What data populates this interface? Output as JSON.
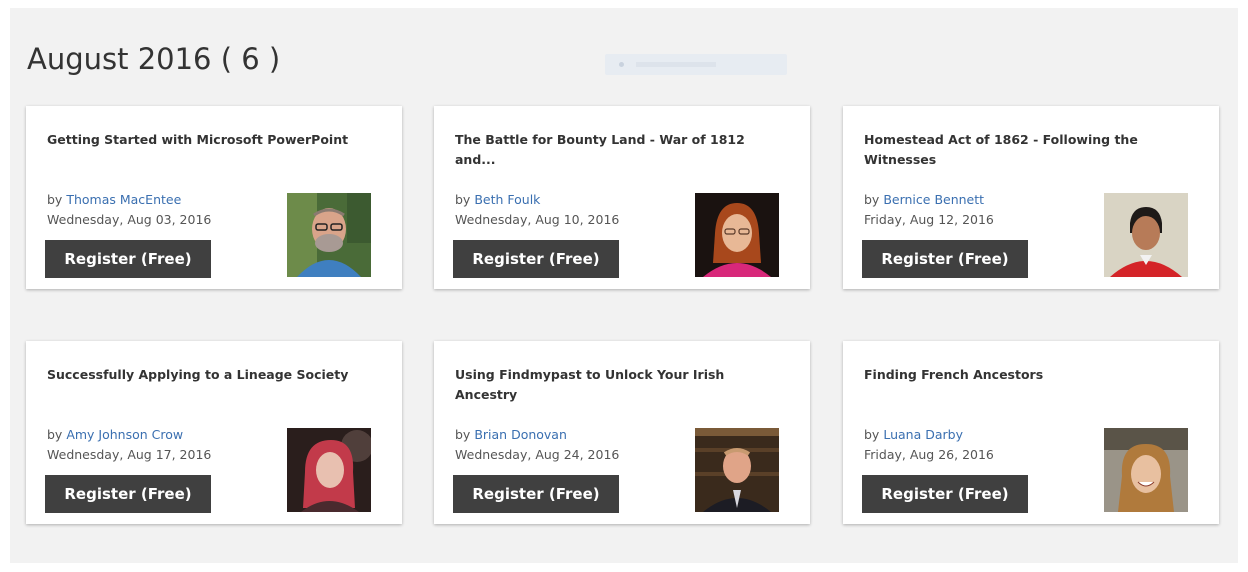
{
  "page": {
    "title": "August 2016 ( 6 )"
  },
  "colors": {
    "accent_link": "#3a6fb0",
    "button_bg": "#404040",
    "page_bg": "#f2f2f2"
  },
  "webinars": [
    {
      "title": "Getting Started with Microsoft PowerPoint",
      "by": "by",
      "author": "Thomas MacEntee",
      "date": "Wednesday, Aug 03, 2016",
      "register_label": "Register (Free)",
      "avatar_icon": "presenter-photo-bearded-man-glasses"
    },
    {
      "title": "The Battle for Bounty Land - War of 1812 and...",
      "by": "by",
      "author": "Beth Foulk",
      "date": "Wednesday, Aug 10, 2016",
      "register_label": "Register (Free)",
      "avatar_icon": "presenter-photo-woman-pink-top"
    },
    {
      "title": "Homestead Act of 1862 - Following the Witnesses",
      "by": "by",
      "author": "Bernice Bennett",
      "date": "Friday, Aug 12, 2016",
      "register_label": "Register (Free)",
      "avatar_icon": "presenter-photo-woman-red-jacket"
    },
    {
      "title": "Successfully Applying to a Lineage Society",
      "by": "by",
      "author": "Amy Johnson Crow",
      "date": "Wednesday, Aug 17, 2016",
      "register_label": "Register (Free)",
      "avatar_icon": "presenter-photo-woman-red-hair"
    },
    {
      "title": "Using Findmypast to Unlock Your Irish Ancestry",
      "by": "by",
      "author": "Brian Donovan",
      "date": "Wednesday, Aug 24, 2016",
      "register_label": "Register (Free)",
      "avatar_icon": "presenter-photo-man-suit-bookshelf"
    },
    {
      "title": "Finding French Ancestors",
      "by": "by",
      "author": "Luana Darby",
      "date": "Friday, Aug 26, 2016",
      "register_label": "Register (Free)",
      "avatar_icon": "presenter-photo-woman-smiling-outdoors"
    }
  ]
}
